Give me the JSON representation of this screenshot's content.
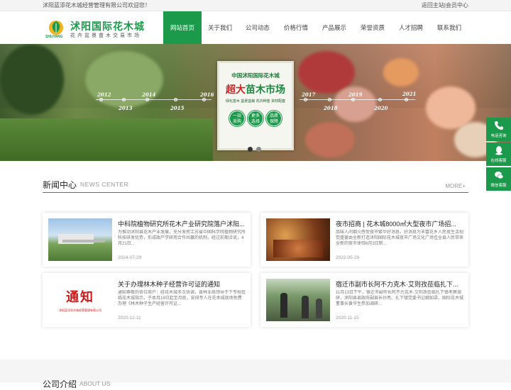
{
  "topbar": {
    "welcome": "沭阳蓝添花木城经营管理有限公司欢迎您！",
    "links": "返回主站|会员中心"
  },
  "logo": {
    "title": "沭阳国际花木城",
    "subtitle": "花卉盆景苗木交易市场",
    "en": "SHUYANG"
  },
  "nav": {
    "items": [
      "网站首页",
      "关于我们",
      "公司动态",
      "价格行情",
      "产品展示",
      "荣誉资质",
      "人才招聘",
      "联系我们"
    ]
  },
  "banner": {
    "years_top": [
      "2012",
      "2014",
      "2016",
      "2017",
      "2019",
      "2021"
    ],
    "years_bottom": [
      "2013",
      "2015",
      "2018",
      "2020"
    ],
    "poster": {
      "line1": "中国沭阳国际花木城",
      "line2a": "超大",
      "line2b": "苗木市场",
      "line3": "绿化苗木  盆景盆栽  花卉种苗  资材配套",
      "circles": [
        [
          "一站",
          "采购"
        ],
        [
          "更多",
          "选择"
        ],
        [
          "品质",
          "保障"
        ]
      ]
    }
  },
  "news": {
    "title": "新闻中心",
    "title_en": "NEWS CENTER",
    "more": "MORE+",
    "cards": [
      {
        "title": "中科院植物研究所花木产业研究院落户沭阳...",
        "desc": "为推动沭阳县花木产业发展，充分发挥江苏省中国科学院植物研究所科技研发优势，形成政产学研用合作共赢的机制，经过前期洽谈，4月21日...",
        "date": "2024-07-29"
      },
      {
        "title": "夜市招商 | 花木城8000㎡大型夜市广场招...",
        "desc": "品味人间烟火感受夜市繁华好消息，好消息为丰富花乡人民夜生活视觉盛宴由全新打造沭阳国际花木城夜市广场文化广场佳全县人民带来全新的夜市体验6月3日新...",
        "date": "2022-05-29"
      },
      {
        "title": "关于办理林木种子经营许可证的通知",
        "desc": "通知尊敬的各位商户：经花木城多次协调，县林业局领导于下专程莅临花木城指示，于本月18日起至月底，安排专人在花木城现场免费办理《林木种子生产经营许可证...",
        "date": "2020-12-11"
      },
      {
        "title": "宿迁市副市长阿不力克木·艾则孜莅临扎下...",
        "desc": "11月13日下午，宿迁市副市长阿不力克木·艾则孜莅临扎下镇考察调研，沭阳县县政府副县长孙亮、扎下镇党委书记细如梁、国际花木城董事长黄华生参加调研...",
        "date": "2020-11-15"
      }
    ],
    "notice_img_text": "通知",
    "notice_img_sub": "沭阳蓝添花木城经营管理有限公司"
  },
  "sidebar": {
    "items": [
      "电话咨询",
      "在线客服",
      "微信客服"
    ]
  },
  "about": {
    "title": "公司介绍",
    "title_en": "ABOUT US"
  },
  "colors": {
    "brand": "#1a9a4a"
  }
}
